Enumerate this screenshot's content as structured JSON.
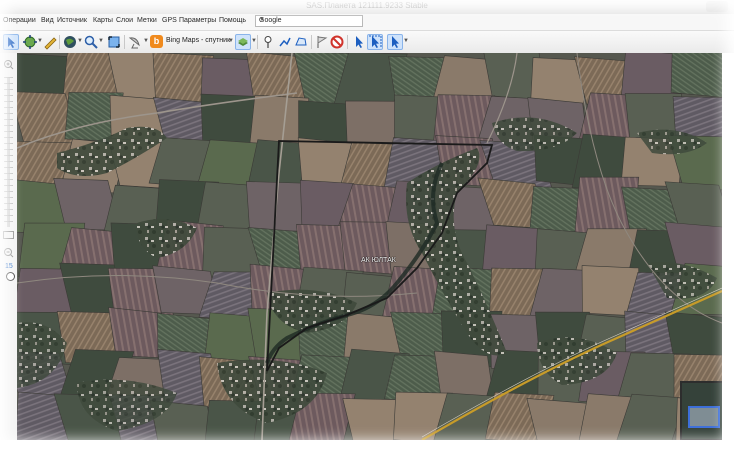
{
  "window": {
    "title": "SAS.Планета 121111.9233 Stable"
  },
  "menu": {
    "items": [
      "Операции",
      "Вид",
      "Источник",
      "Карты",
      "Слои",
      "Метки",
      "GPS",
      "Параметры",
      "Помощь"
    ],
    "provider_label": "Google"
  },
  "toolbar": {
    "layer_label": "Bing Maps - спутник"
  },
  "sidebar": {
    "zoom_level": "15"
  },
  "map": {
    "label": "АК ЮЛТАК"
  },
  "colors": {
    "accent": "#3d6fd9",
    "bing": "#f08a1d",
    "boundary": "#1a1a1a",
    "road": "#c79b29"
  }
}
